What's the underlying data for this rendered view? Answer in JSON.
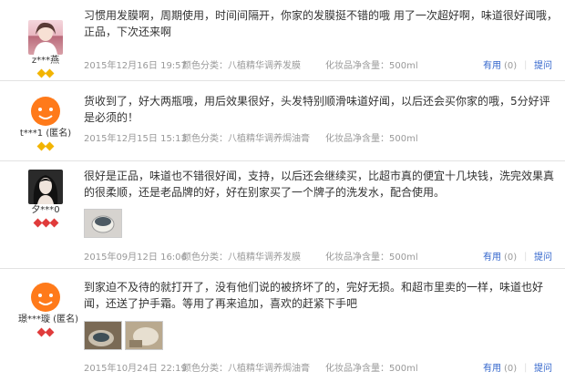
{
  "reviews": [
    {
      "user": "z***燕",
      "badge_count": 2,
      "badge_color": "#f2b400",
      "text": "习惯用发膜啊，周期使用，时间间隔开，你家的发膜挺不错的哦 用了一次超好啊，味道很好闻哦，正品，下次还来啊",
      "date": "2015年12月16日 19:57",
      "color_class": "颜色分类：八植精华调养发膜",
      "volume": "化妆品净含量：500ml",
      "useful_label": "有用",
      "useful_count": "(0)",
      "ask_label": "提问"
    },
    {
      "user": "t***1 (匿名)",
      "badge_count": 2,
      "badge_color": "#f2b400",
      "text": "货收到了，好大两瓶哦，用后效果很好，头发特别顺滑味道好闻，以后还会买你家的哦，5分好评是必须的！",
      "date": "2015年12月15日 15:13",
      "color_class": "颜色分类：八植精华调养焗油膏",
      "volume": "化妆品净含量：500ml",
      "useful_label": "有用",
      "useful_count": "(0)",
      "ask_label": "提问"
    },
    {
      "user": "夕***0",
      "badge_count": 3,
      "badge_color": "#e03b3b",
      "text": "很好是正品，味道也不错很好闻，支持，以后还会继续买，比超市真的便宜十几块钱，洗完效果真的很柔顺，还是老品牌的好，好在别家买了一个牌子的洗发水，配合使用。",
      "date": "2015年09月12日 16:06",
      "color_class": "颜色分类：八植精华调养发膜",
      "volume": "化妆品净含量：500ml",
      "useful_label": "有用",
      "useful_count": "(0)",
      "ask_label": "提问"
    },
    {
      "user": "璟***璇 (匿名)",
      "badge_count": 2,
      "badge_color": "#e03b3b",
      "text": "到家迫不及待的就打开了，没有他们说的被挤坏了的，完好无损。和超市里卖的一样，味道也好闻，还送了护手霜。等用了再来追加，喜欢的赶紧下手吧",
      "date": "2015年10月24日 22:19",
      "color_class": "颜色分类：八植精华调养焗油膏",
      "volume": "化妆品净含量：500ml",
      "useful_label": "有用",
      "useful_count": "(0)",
      "ask_label": "提问"
    }
  ]
}
